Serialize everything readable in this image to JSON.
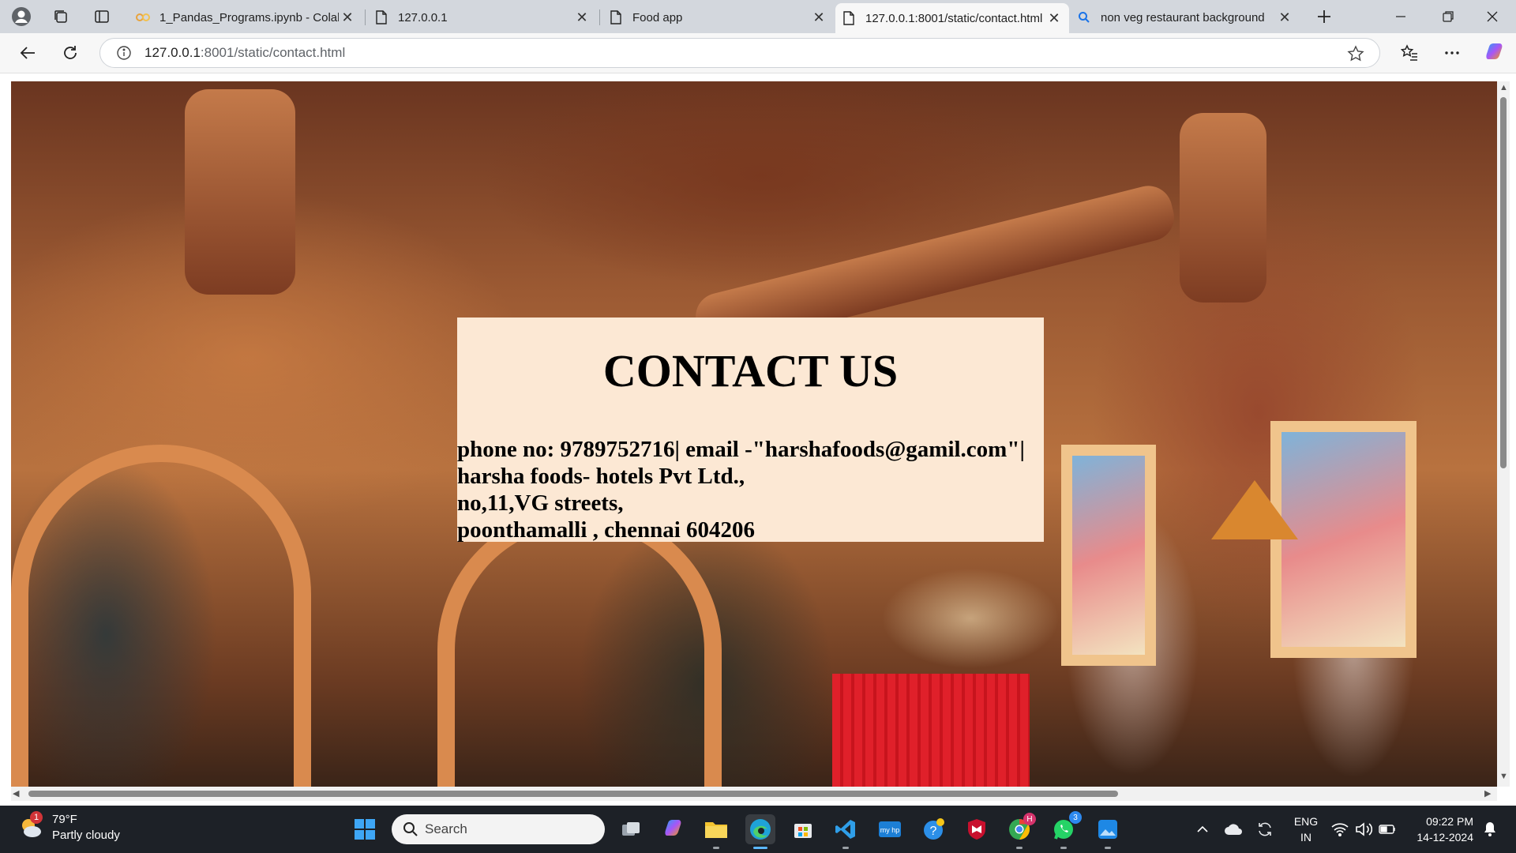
{
  "browser": {
    "tabs": [
      {
        "title": "1_Pandas_Programs.ipynb - Colab",
        "icon": "colab-icon"
      },
      {
        "title": "127.0.0.1",
        "icon": "page-icon"
      },
      {
        "title": "Food app",
        "icon": "page-icon"
      },
      {
        "title": "127.0.0.1:8001/static/contact.html",
        "icon": "page-icon",
        "active": true
      },
      {
        "title": "non veg restaurant background",
        "icon": "search-icon"
      }
    ],
    "address": {
      "host": "127.0.0.1",
      "rest": ":8001/static/contact.html"
    }
  },
  "page": {
    "heading": "CONTACT US",
    "lines": [
      "phone no: 9789752716| email -\"harshafoods@gamil.com\"|",
      "harsha foods- hotels Pvt Ltd.,",
      "no,11,VG streets,",
      "poonthamalli , chennai 604206"
    ]
  },
  "taskbar": {
    "weather": {
      "temp": "79°F",
      "condition": "Partly cloudy",
      "badge": "1"
    },
    "search_label": "Search",
    "whatsapp_badge": "3",
    "chrome_badge": "H",
    "lang": {
      "line1": "ENG",
      "line2": "IN"
    },
    "clock": {
      "time": "09:22 PM",
      "date": "14-12-2024"
    }
  },
  "colors": {
    "tabstrip": "#d3d7dd",
    "contact_box": "#fce8d4",
    "taskbar": "#1d2127",
    "accent": "#0078d4"
  }
}
